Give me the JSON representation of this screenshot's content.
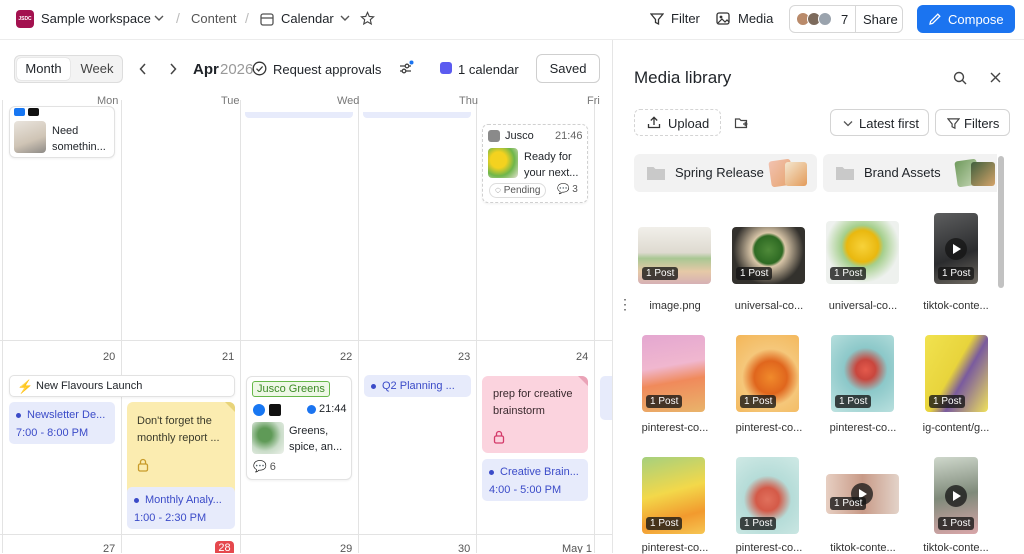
{
  "topbar": {
    "workspace_logo": "JSDC",
    "workspace_name": "Sample workspace",
    "breadcrumb_content": "Content",
    "breadcrumb_calendar": "Calendar",
    "filter_label": "Filter",
    "media_label": "Media",
    "member_count": "7",
    "share_label": "Share",
    "compose_label": "Compose",
    "accent_color": "#1b74f0"
  },
  "calendar": {
    "view_month": "Month",
    "view_week": "Week",
    "month": "Apr",
    "year": "2026",
    "request_approvals": "Request approvals",
    "calendars_label": "1 calendar",
    "saved_label": "Saved",
    "day_headers": [
      "Mon",
      "Tue",
      "Wed",
      "Thu",
      "Fri"
    ],
    "week2_dates": [
      "20",
      "21",
      "22",
      "23",
      "24"
    ],
    "week3_dates": [
      "27",
      "28",
      "29",
      "30",
      "May 1"
    ],
    "today_date": "28",
    "week1": {
      "mon_post_text": "Need somethin...",
      "thu_post": {
        "account": "Jusco",
        "time": "21:46",
        "text": "Ready for your next...",
        "status": "Pending",
        "comments": "3"
      }
    },
    "week2": {
      "campaign_label": "New Flavours Launch",
      "newsletter": {
        "title": "Newsletter De...",
        "time": "7:00 - 8:00 PM"
      },
      "reminder_note": "Don't forget the monthly report ...",
      "monthly_analysis": {
        "title": "Monthly Analy...",
        "time": "1:00 - 2:30 PM"
      },
      "greens_post": {
        "tag": "Jusco Greens",
        "time": "21:44",
        "text": "Greens, spice, an...",
        "comments": "6"
      },
      "q2_planning": "Q2 Planning ...",
      "prep_note": "prep for creative brainstorm",
      "creative_brain": {
        "title": "Creative Brain...",
        "time": "4:00 - 5:00 PM"
      }
    }
  },
  "media_library": {
    "title": "Media library",
    "upload_label": "Upload",
    "sort_label": "Latest first",
    "filters_label": "Filters",
    "folders": [
      "Spring Release",
      "Brand Assets"
    ],
    "post_badge": "1 Post",
    "items": [
      {
        "name": "image.png",
        "video": false
      },
      {
        "name": "universal-co...",
        "video": false
      },
      {
        "name": "universal-co...",
        "video": false
      },
      {
        "name": "tiktok-conte...",
        "video": true
      },
      {
        "name": "pinterest-co...",
        "video": false
      },
      {
        "name": "pinterest-co...",
        "video": false
      },
      {
        "name": "pinterest-co...",
        "video": false
      },
      {
        "name": "ig-content/g...",
        "video": false
      },
      {
        "name": "pinterest-co...",
        "video": false
      },
      {
        "name": "pinterest-co...",
        "video": false
      },
      {
        "name": "tiktok-conte...",
        "video": true
      },
      {
        "name": "tiktok-conte...",
        "video": true
      }
    ]
  }
}
